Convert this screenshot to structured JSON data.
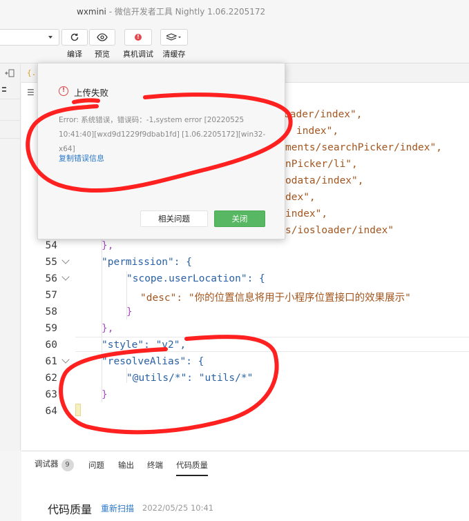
{
  "window": {
    "app_name": "wxmini",
    "separator": " - ",
    "subtitle": "微信开发者工具 Nightly 1.06.2205172"
  },
  "toolbar": {
    "compile_label": "编译",
    "preview_label": "预览",
    "remote_debug_label": "真机调试",
    "clear_cache_label": "清缓存"
  },
  "dialog": {
    "title": "上传失败",
    "error_message": "Error: 系统错误，错误码：-1,system error [20220525 10:41:40][wxd9d1229f9dbab1fd] [1.06.2205172][win32-x64]",
    "copy_link": "复制错误信息",
    "related_button": "相关问题",
    "close_button": "关闭"
  },
  "code_lines": [
    {
      "n": "54",
      "text": "},"
    },
    {
      "n": "55",
      "text": "\"permission\": {"
    },
    {
      "n": "56",
      "text": "\"scope.userLocation\": {"
    },
    {
      "n": "57",
      "text": "\"desc\": \"你的位置信息将用于小程序位置接口的效果展示\""
    },
    {
      "n": "58",
      "text": "}"
    },
    {
      "n": "59",
      "text": "},"
    },
    {
      "n": "60",
      "text": "\"style\": \"v2\","
    },
    {
      "n": "61",
      "text": "\"resolveAlias\": {"
    },
    {
      "n": "62",
      "text": "\"@utils/*\": \"utils/*\""
    },
    {
      "n": "63",
      "text": "}"
    },
    {
      "n": "64",
      "text": ""
    }
  ],
  "code_fragments": {
    "f1": "oader/index\",",
    "f2": "index\",",
    "f3": "ments/searchPicker/index\",",
    "f4": "nPicker/li\",",
    "f5": "odata/index\",",
    "f6": "dex\",",
    "f7": "index\",",
    "f8": "s/iosloader/index\""
  },
  "bottom_panel": {
    "tabs": [
      {
        "label": "调试器",
        "badge": "9"
      },
      {
        "label": "问题"
      },
      {
        "label": "输出"
      },
      {
        "label": "终端"
      },
      {
        "label": "代码质量"
      }
    ],
    "heading": "代码质量",
    "rescan_link": "重新扫描",
    "timestamp": "2022/05/25 10:41"
  },
  "colors": {
    "accent_green": "#57b762",
    "link_blue": "#2a78c9",
    "error_red": "#e24444",
    "scribble_red": "#ff2020"
  }
}
